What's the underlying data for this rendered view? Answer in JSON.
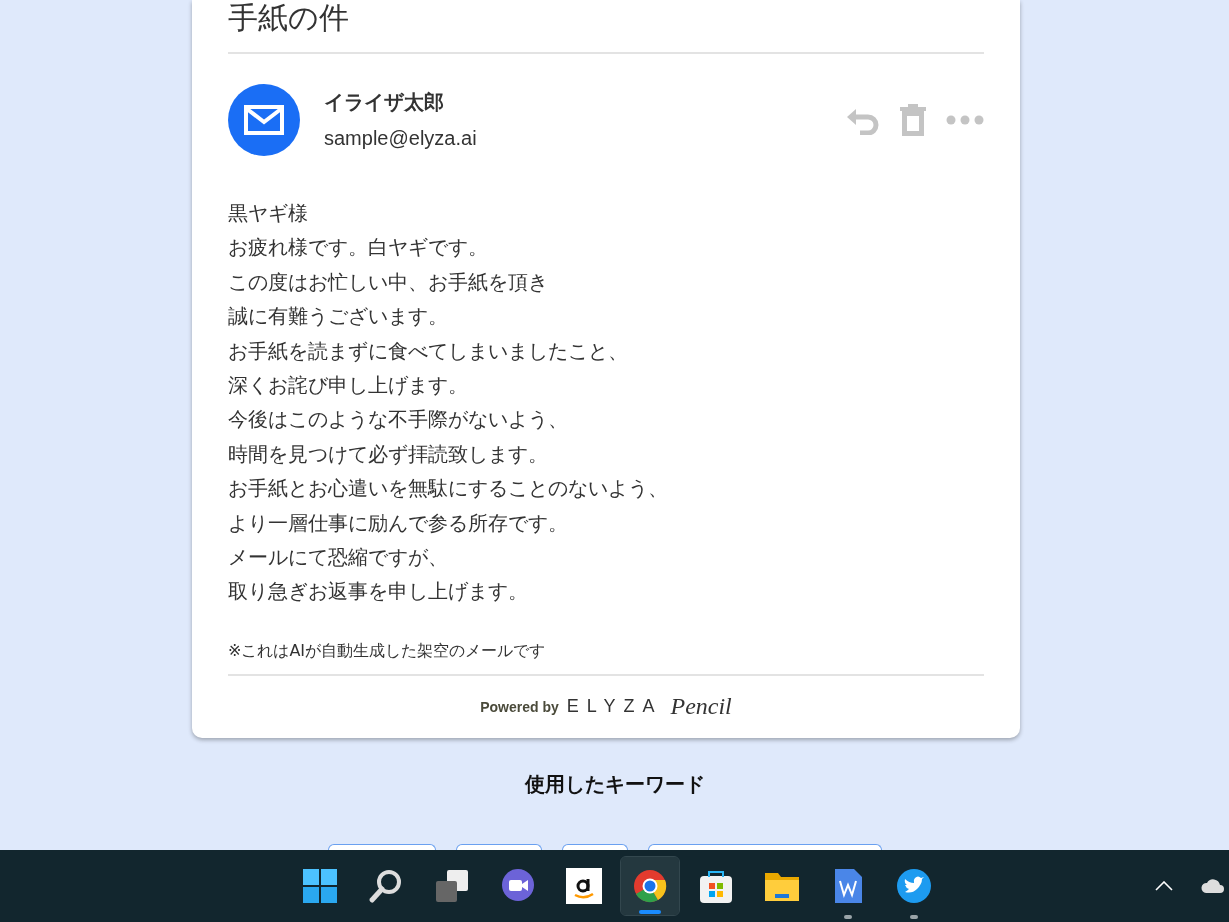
{
  "mail": {
    "subject": "手紙の件",
    "sender_name": "イライザ太郎",
    "sender_email": "sample@elyza.ai",
    "body_lines": [
      "黒ヤギ様",
      "お疲れ様です。白ヤギです。",
      "この度はお忙しい中、お手紙を頂き",
      "誠に有難うございます。",
      "お手紙を読まずに食べてしまいましたこと、",
      "深くお詫び申し上げます。",
      "今後はこのような不手際がないよう、",
      "時間を見つけて必ず拝読致します。",
      "お手紙とお心遣いを無駄にすることのないよう、",
      "より一層仕事に励んで参る所存です。",
      "メールにて恐縮ですが、",
      "取り急ぎお返事を申し上げます。"
    ],
    "note": "※これはAIが自動生成した架空のメールです",
    "footer": {
      "powered_by": "Powered by",
      "brand": "ELYZA",
      "brand_script": "Pencil"
    }
  },
  "keywords": {
    "heading": "使用したキーワード"
  },
  "taskbar": {
    "apps": [
      {
        "kind": "start",
        "selected": false,
        "running": false
      },
      {
        "kind": "search",
        "selected": false,
        "running": false
      },
      {
        "kind": "windows",
        "selected": false,
        "running": false
      },
      {
        "kind": "video",
        "selected": false,
        "running": false
      },
      {
        "kind": "shop-a",
        "selected": false,
        "running": false
      },
      {
        "kind": "browser",
        "selected": true,
        "running": true
      },
      {
        "kind": "store",
        "selected": false,
        "running": false
      },
      {
        "kind": "folder",
        "selected": false,
        "running": false
      },
      {
        "kind": "doc",
        "selected": false,
        "running": true
      },
      {
        "kind": "bird",
        "selected": false,
        "running": true
      }
    ]
  }
}
